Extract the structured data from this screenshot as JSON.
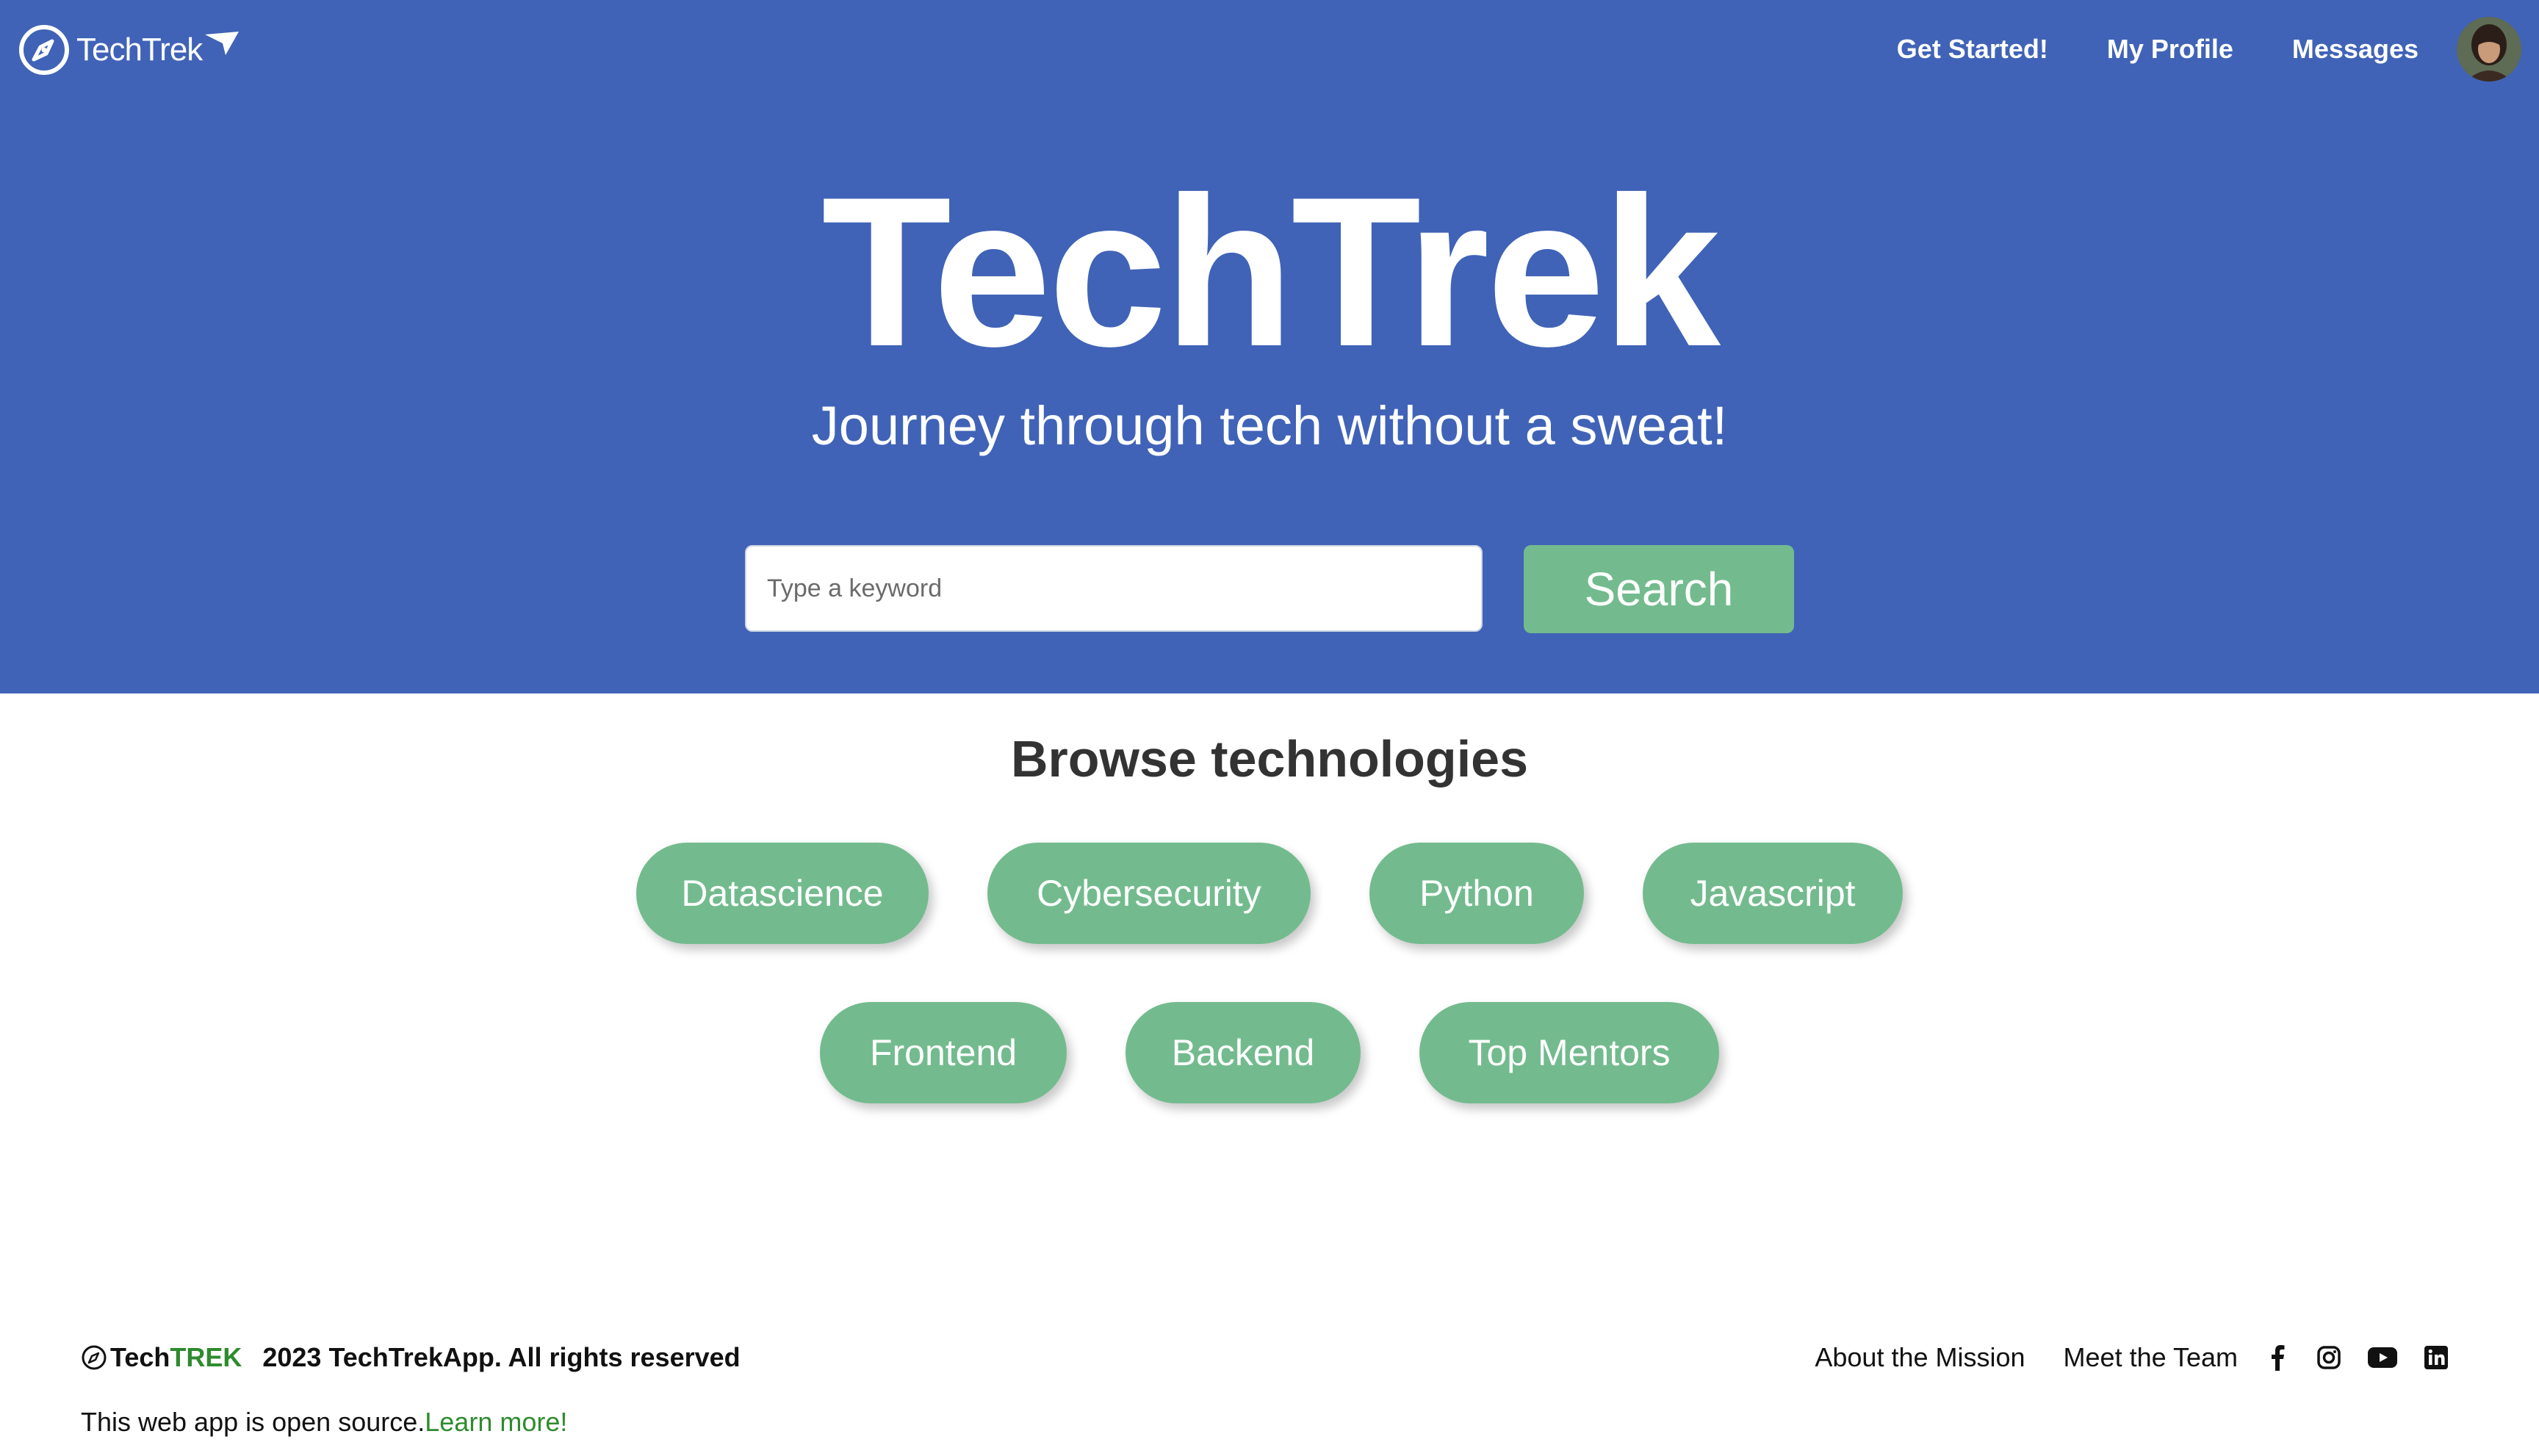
{
  "header": {
    "logo_text": "TechTrek",
    "nav": [
      {
        "label": "Get Started!"
      },
      {
        "label": "My Profile"
      },
      {
        "label": "Messages"
      }
    ]
  },
  "hero": {
    "title": "TechTrek",
    "subtitle": "Journey through tech without a sweat!"
  },
  "search": {
    "placeholder": "Type a keyword",
    "value": "",
    "button_label": "Search"
  },
  "browse": {
    "title": "Browse technologies",
    "chips": [
      {
        "label": "Datascience"
      },
      {
        "label": "Cybersecurity"
      },
      {
        "label": "Python"
      },
      {
        "label": "Javascript"
      },
      {
        "label": "Frontend"
      },
      {
        "label": "Backend"
      },
      {
        "label": "Top Mentors"
      }
    ]
  },
  "footer": {
    "brand_tech": "Tech",
    "brand_trek": "TREK",
    "rights": "2023 TechTrekApp. All rights reserved",
    "open_source_text": "This web app is open source.",
    "learn_more": "Learn more!",
    "links": [
      {
        "label": "About the Mission"
      },
      {
        "label": "Meet the Team"
      }
    ],
    "social_icons": [
      "facebook-icon",
      "instagram-icon",
      "youtube-icon",
      "linkedin-icon"
    ]
  },
  "colors": {
    "hero_background": "#4063b7",
    "accent_green": "#73bb8e",
    "link_green": "#2e8b2e"
  }
}
